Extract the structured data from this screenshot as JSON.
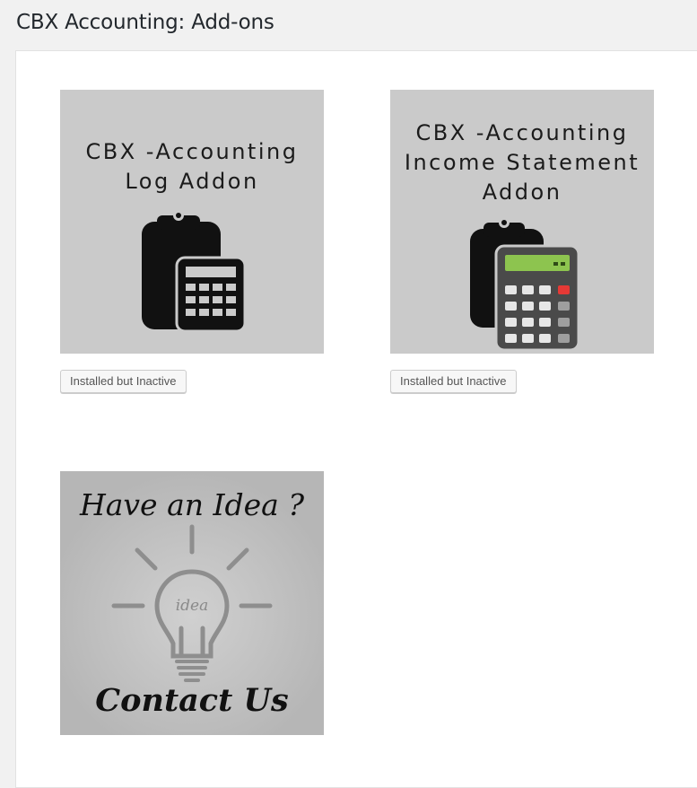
{
  "page": {
    "title": "CBX Accounting: Add-ons"
  },
  "addons": [
    {
      "title": "CBX -Accounting\nLog Addon",
      "status_label": "Installed but Inactive",
      "icon": "clipboard-calculator-icon"
    },
    {
      "title": "CBX -Accounting\nIncome Statement\nAddon",
      "status_label": "Installed but Inactive",
      "icon": "clipboard-colored-calculator-icon"
    }
  ],
  "idea_card": {
    "headline": "Have an Idea ?",
    "bulb_text": "idea",
    "cta": "Contact Us",
    "icon": "lightbulb-icon"
  },
  "colors": {
    "card_bg": "#cacaca",
    "calc_screen": "#8dc44f",
    "calc_red_key": "#e53935"
  }
}
